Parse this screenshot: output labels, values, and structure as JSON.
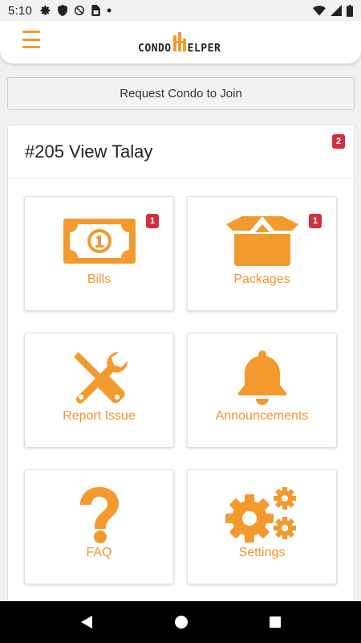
{
  "status_bar": {
    "time": "5:10",
    "icons": [
      "gear-icon",
      "shield-icon",
      "no-disturb-icon",
      "sim-card-icon",
      "dot-icon",
      "wifi-icon",
      "signal-icon",
      "battery-icon"
    ]
  },
  "app_bar": {
    "logo_left": "CONDO",
    "logo_right": "ELPER",
    "menu_icon": "hamburger-icon"
  },
  "join_button": {
    "label": "Request Condo to Join"
  },
  "unit": {
    "title": "#205 View Talay",
    "badge": "2"
  },
  "tiles": [
    {
      "label": "Bills",
      "icon": "banknote-icon",
      "badge": "1"
    },
    {
      "label": "Packages",
      "icon": "box-icon",
      "badge": "1"
    },
    {
      "label": "Report Issue",
      "icon": "tools-icon",
      "badge": ""
    },
    {
      "label": "Announcements",
      "icon": "bell-icon",
      "badge": ""
    },
    {
      "label": "FAQ",
      "icon": "question-icon",
      "badge": ""
    },
    {
      "label": "Settings",
      "icon": "gears-icon",
      "badge": ""
    }
  ],
  "colors": {
    "accent": "#f39a2e",
    "badge": "#d32f3f"
  },
  "nav_bar": {
    "icons": [
      "back-icon",
      "home-icon",
      "recents-icon"
    ]
  }
}
